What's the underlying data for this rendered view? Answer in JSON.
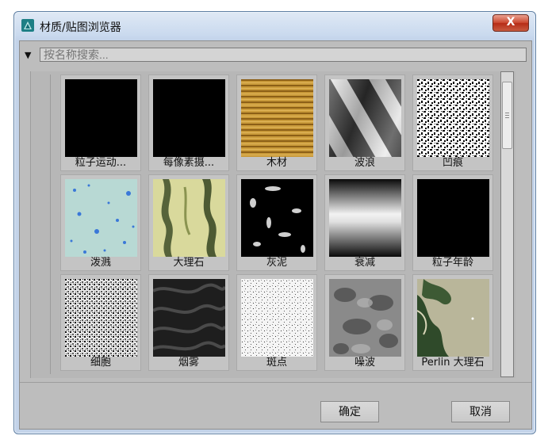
{
  "window": {
    "title": "材质/贴图浏览器",
    "close_label": "X"
  },
  "search": {
    "placeholder": "按名称搜索..."
  },
  "materials": [
    {
      "label": "粒子运动..."
    },
    {
      "label": "每像素摄..."
    },
    {
      "label": "木材"
    },
    {
      "label": "波浪"
    },
    {
      "label": "凹痕"
    },
    {
      "label": "泼溅"
    },
    {
      "label": "大理石"
    },
    {
      "label": "灰泥"
    },
    {
      "label": "衰减"
    },
    {
      "label": "粒子年龄"
    },
    {
      "label": "细胞"
    },
    {
      "label": "烟雾"
    },
    {
      "label": "斑点"
    },
    {
      "label": "噪波"
    },
    {
      "label": "Perlin 大理石"
    }
  ],
  "buttons": {
    "ok": "确定",
    "cancel": "取消"
  },
  "colors": {
    "accent": "#c84a32",
    "panel": "#bdbdbd"
  }
}
